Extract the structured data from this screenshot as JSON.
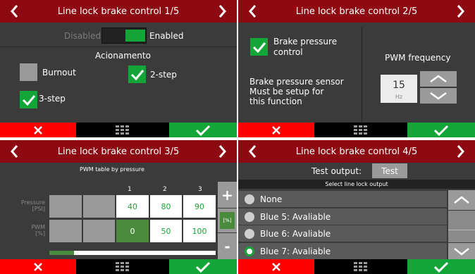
{
  "screens": [
    {
      "title": "Line lock brake control 1/5"
    },
    {
      "title": "Line lock brake control 2/5"
    },
    {
      "title": "Line lock brake control 3/5"
    },
    {
      "title": "Line lock brake control 4/5"
    }
  ],
  "s1": {
    "disabled_label": "Disabled",
    "enabled_label": "Enabled",
    "section": "Acionamento",
    "burnout": "Burnout",
    "two_step": "2-step",
    "three_step": "3-step"
  },
  "s2": {
    "brake_pressure_line1": "Brake pressure",
    "brake_pressure_line2": "control",
    "note_line1": "Brake pressure sensor",
    "note_line2": "Must be setup for",
    "note_line3": "this function",
    "pwm_label": "PWM frequency",
    "pwm_value": "15",
    "pwm_unit": "Hz"
  },
  "s3": {
    "table_title": "PWM table by pressure",
    "columns": [
      "1",
      "2",
      "3"
    ],
    "pressure_label_1": "Pressure",
    "pressure_label_2": "[PSI]",
    "pwm_label_1": "PWM",
    "pwm_label_2": "[%]",
    "pressure_values": [
      "40",
      "80",
      "90"
    ],
    "pwm_values": [
      "0",
      "50",
      "100"
    ],
    "unit_toggle": "[%]",
    "plus": "+",
    "minus": "-",
    "scroll_progress": 0.15
  },
  "s4": {
    "test_output_label": "Test output:",
    "test_button": "Test",
    "list_title": "Select line lock output",
    "options": [
      "None",
      "Blue 5: Avaliable",
      "Blue 6: Avaliable",
      "Blue 7: Avaliable"
    ],
    "selected_index": 3
  },
  "colors": {
    "header": "#8e0a12",
    "cancel": "#ff0000",
    "confirm": "#13a538",
    "background": "#3b3b3b"
  }
}
